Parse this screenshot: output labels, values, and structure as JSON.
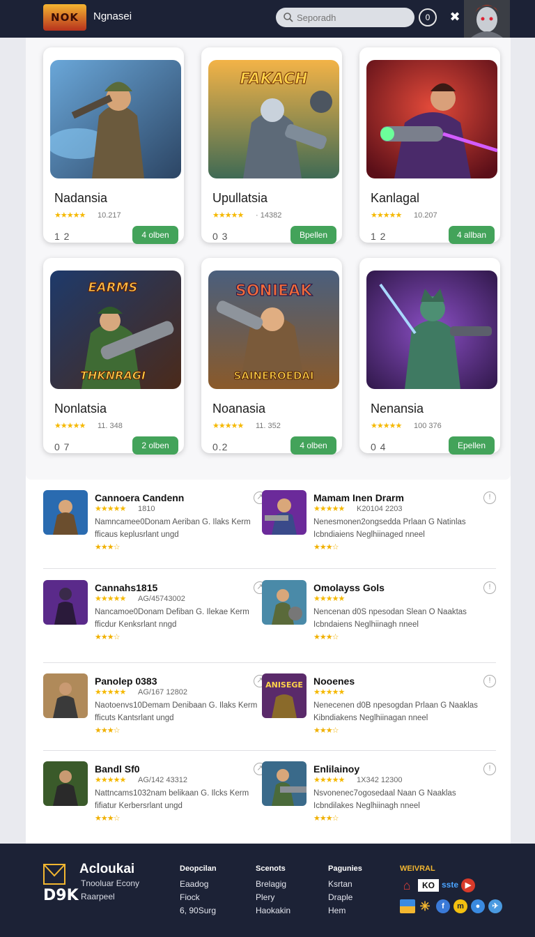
{
  "header": {
    "logo_text": "NOK",
    "site_name": "Ngnasei",
    "search_placeholder": "Seporadh",
    "circle_button": "0"
  },
  "featured": [
    {
      "title": "Nadansia",
      "rating": "10.217",
      "count": "1 2",
      "button": "4 olben"
    },
    {
      "title": "Upullatsia",
      "rating": "· 14382",
      "count": "0 3",
      "button": "Bpellen"
    },
    {
      "title": "Kanlagal",
      "rating": "10.207",
      "count": "1 2",
      "button": "4 allban"
    },
    {
      "title": "Nonlatsia",
      "rating": "11. 348",
      "count": "0 7",
      "button": "2 olben"
    },
    {
      "title": "Noanasia",
      "rating": "11. 352",
      "count": "0.2",
      "button": "4 olben"
    },
    {
      "title": "Nenansia",
      "rating": "100 376",
      "count": "0 4",
      "button": "Epellen"
    }
  ],
  "card_art_text": [
    "",
    "FAKACH",
    "",
    "EARMS",
    "SONIEAK",
    ""
  ],
  "card_art_text2": [
    "",
    "",
    "",
    "THKNRAGI",
    "SAINEROEDAI",
    ""
  ],
  "list": [
    {
      "name": "Cannoera Candenn",
      "meta": "1810",
      "desc": "Namncamee0Donam Aeriban G. Ilaks Kerm fficaus keplusrlant ungd"
    },
    {
      "name": "Mamam Inen Drarm",
      "meta": "K20104 2203",
      "desc": "Nenesmonen2ongsedda Prlaan G Natinlas Icbndiaiens Neglhiinaged nneel"
    },
    {
      "name": "Cannahs1815",
      "meta": "AG/45743002",
      "desc": "Nancamoe0Donam Defiban G. Ilekae Kerm fficdur Kenksrlant nngd"
    },
    {
      "name": "Omolayss Gols",
      "meta": "",
      "desc": "Nencenan d0S npesodan Slean O Naaktas Icbndaiens Neglhiinagh nneel"
    },
    {
      "name": "Panolep 0383",
      "meta": "AG/167 12802",
      "desc": "Naotoenvs10Demam Denibaan G. Ilaks Kerm fficuts Kantsrlant ungd"
    },
    {
      "name": "Nooenes",
      "meta": "",
      "desc": "Nenecenen d0B npesogdan Prlaan G Naaklas Kibndiakens Neglhiinagan nneel"
    },
    {
      "name": "Bandl Sf0",
      "meta": "AG/142 43312",
      "desc": "Nattncams1032nam belikaan G. Ilcks Kerm fifiatur Kerbersrlant ungd"
    },
    {
      "name": "Enlilainoy",
      "meta": "1X342 12300",
      "desc": "Nsvonenec7ogosedaal Naan G Naaklas Icbndilakes Neglhiinagh nneel"
    }
  ],
  "footer": {
    "logo_mark": "D9K",
    "brand": "Acloukai",
    "tagline1": "Tnooluar Econy",
    "tagline2": "Raarpeel",
    "columns": [
      {
        "head": "Deopcilan",
        "links": [
          "Eaadog",
          "Fiock",
          "6, 90Surg"
        ]
      },
      {
        "head": "Scenots",
        "links": [
          "Brelagig",
          "Plery",
          "Haokakin"
        ]
      },
      {
        "head": "Pagunies",
        "links": [
          "Ksrtan",
          "Draple",
          "Hem"
        ]
      }
    ],
    "social_title": "WEIVRAL",
    "badge_text": "KO",
    "badge_text2": "sste"
  },
  "colors": {
    "header_bg": "#1c2236",
    "button_green": "#43a35a",
    "star": "#f5b800",
    "accent_gold": "#f3b730"
  }
}
